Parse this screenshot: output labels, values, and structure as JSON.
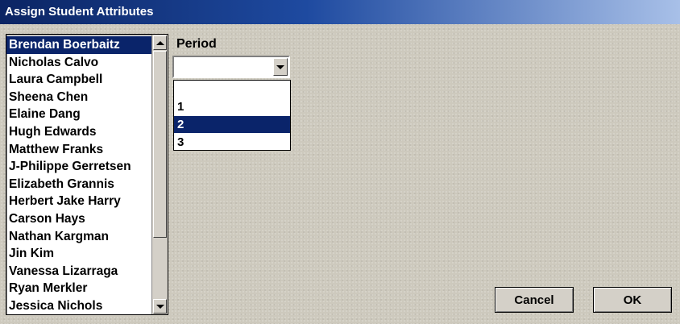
{
  "window": {
    "title": "Assign Student Attributes"
  },
  "students": {
    "selected_index": 0,
    "items": [
      "Brendan Boerbaitz",
      "Nicholas Calvo",
      "Laura Campbell",
      "Sheena Chen",
      "Elaine Dang",
      "Hugh Edwards",
      "Matthew Franks",
      "J-Philippe Gerretsen",
      "Elizabeth Grannis",
      "Herbert Jake Harry",
      "Carson Hays",
      "Nathan Kargman",
      "Jin Kim",
      "Vanessa Lizarraga",
      "Ryan Merkler",
      "Jessica Nichols"
    ]
  },
  "period": {
    "label": "Period",
    "value": "",
    "options": [
      "",
      "1",
      "2",
      "3"
    ],
    "highlighted": "2"
  },
  "buttons": {
    "cancel": "Cancel",
    "ok": "OK"
  },
  "colors": {
    "selection": "#0a246a",
    "titlebar_start": "#0b2463",
    "titlebar_end": "#a8c0e8"
  },
  "icons": {
    "scroll_up": "triangle-up-icon",
    "scroll_down": "triangle-down-icon",
    "combo_arrow": "triangle-down-icon"
  }
}
